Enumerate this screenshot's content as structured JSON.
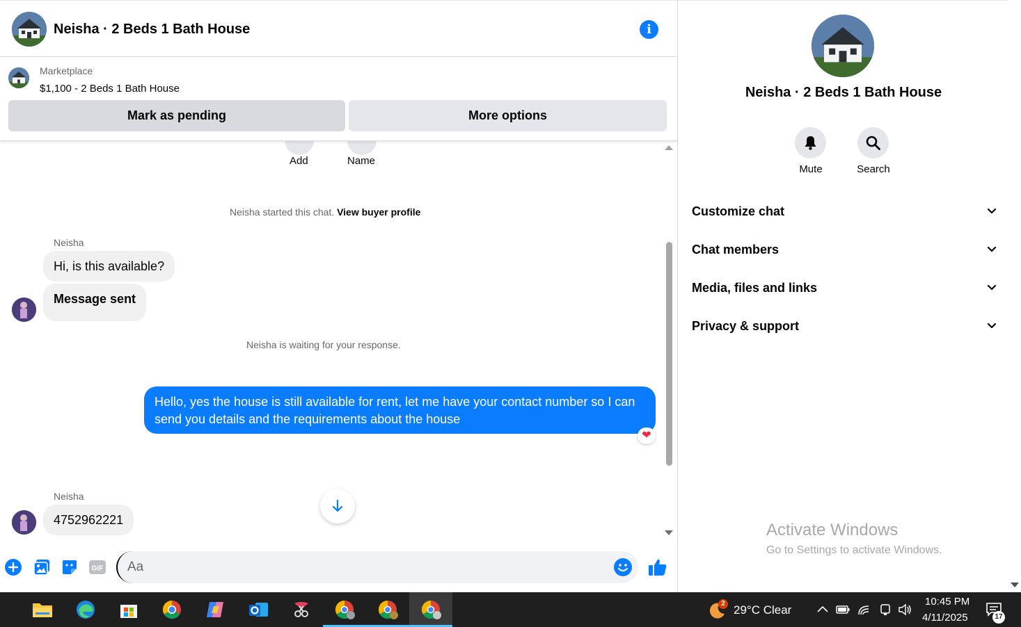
{
  "chat": {
    "title": "Neisha · 2 Beds 1 Bath House",
    "listing": {
      "source": "Marketplace",
      "title": "$1,100 - 2 Beds 1 Bath House",
      "pending_label": "Mark as pending",
      "more_label": "More options"
    },
    "quick_actions": [
      {
        "label": "Add"
      },
      {
        "label": "Name"
      }
    ],
    "started_text": "Neisha started this chat.",
    "view_profile_label": "View buyer profile",
    "messages": [
      {
        "sender": "Neisha",
        "text": "Hi, is this available?"
      },
      {
        "text": "Message sent"
      }
    ],
    "waiting_text": "Neisha is waiting for your response.",
    "outgoing": {
      "text": "Hello, yes the house is still available for rent, let me have your contact number so I can send you details and the requirements about the house",
      "reaction": "❤"
    },
    "reply": {
      "sender": "Neisha",
      "text": "4752962221"
    },
    "composer": {
      "placeholder": "Aa"
    }
  },
  "details": {
    "title": "Neisha · 2 Beds 1 Bath House",
    "actions": [
      {
        "label": "Mute"
      },
      {
        "label": "Search"
      }
    ],
    "sections": [
      {
        "label": "Customize chat"
      },
      {
        "label": "Chat members"
      },
      {
        "label": "Media, files and links"
      },
      {
        "label": "Privacy & support"
      }
    ],
    "watermark": {
      "title": "Activate Windows",
      "subtitle": "Go to Settings to activate Windows."
    }
  },
  "taskbar": {
    "weather": {
      "badge": "2",
      "text": "29°C  Clear"
    },
    "clock": {
      "time": "10:45 PM",
      "date": "4/11/2025"
    },
    "notifications": "17"
  },
  "colors": {
    "accent": "#0a7cff",
    "bubble_in": "#f0f0f0",
    "button_gray": "#e4e6eb",
    "taskbar": "#1f1f1f"
  }
}
